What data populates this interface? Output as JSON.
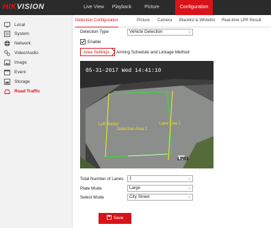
{
  "logo": {
    "brand_red": "HIK",
    "brand_rest": "VISION"
  },
  "nav": [
    "Live View",
    "Playback",
    "Picture",
    "Configuration"
  ],
  "sidebar": {
    "items": [
      {
        "label": "Local",
        "icon": "monitor-icon"
      },
      {
        "label": "System",
        "icon": "system-icon"
      },
      {
        "label": "Network",
        "icon": "globe-icon"
      },
      {
        "label": "Video/Audio",
        "icon": "video-audio-icon"
      },
      {
        "label": "Image",
        "icon": "image-icon"
      },
      {
        "label": "Event",
        "icon": "calendar-icon"
      },
      {
        "label": "Storage",
        "icon": "storage-icon"
      },
      {
        "label": "Road Traffic",
        "icon": "car-icon"
      }
    ]
  },
  "tabs": [
    "Detection Configuration",
    "Picture",
    "Camera",
    "Blacklist & Whitelist",
    "Real-time LPR Result"
  ],
  "form": {
    "detection_type_label": "Detection Type",
    "detection_type_value": "Vehicle Detection",
    "enable_label": "Enable",
    "enable_checked": true,
    "subtabs": [
      "Area Settings",
      "Arming Schedule and Linkage Method"
    ],
    "lanes_label": "Total Number of Lanes",
    "lanes_value": "1",
    "plate_mode_label": "Plate Mode",
    "plate_mode_value": "Large",
    "select_mode_label": "Select Mode",
    "select_mode_value": "City Street"
  },
  "video": {
    "timestamp": "05-31-2017 Wed 14:41:10",
    "left_border_label": "Left Border",
    "detection_area_label": "Detection Area 1",
    "lane_line_label": "Lane Line 1",
    "lpr_label": "LPR1"
  },
  "save_label": "Save",
  "colors": {
    "accent": "#d7141a",
    "area": "#33dd33",
    "lane": "#e8e030"
  }
}
